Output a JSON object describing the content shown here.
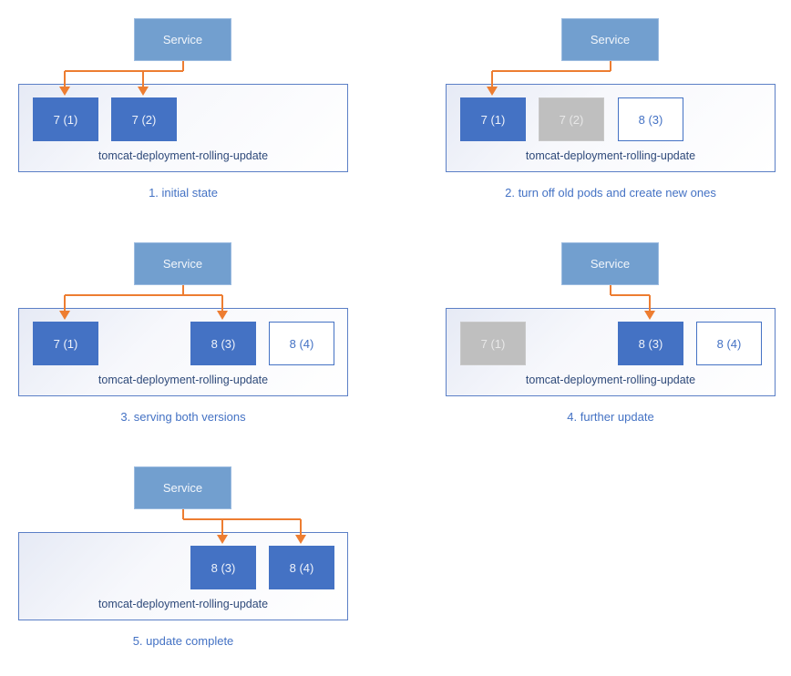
{
  "colors": {
    "service": "#729fcf",
    "pod_active": "#4472c4",
    "pod_off": "#bfbfbf",
    "pod_new_border": "#4472c4",
    "arrow": "#ed7d31",
    "caption": "#4472c4"
  },
  "panels": [
    {
      "service_label": "Service",
      "deployment_label": "tomcat-deployment-rolling-update",
      "caption": "1. initial state",
      "pods": [
        {
          "label": "7 (1)",
          "state": "active",
          "slot": 0
        },
        {
          "label": "7 (2)",
          "state": "active",
          "slot": 1
        }
      ],
      "routes_to_slots": [
        0,
        1
      ]
    },
    {
      "service_label": "Service",
      "deployment_label": "tomcat-deployment-rolling-update",
      "caption": "2. turn off old pods and create new ones",
      "pods": [
        {
          "label": "7 (1)",
          "state": "active",
          "slot": 0
        },
        {
          "label": "7 (2)",
          "state": "off",
          "slot": 1
        },
        {
          "label": "8 (3)",
          "state": "new",
          "slot": 2
        }
      ],
      "routes_to_slots": [
        0
      ]
    },
    {
      "service_label": "Service",
      "deployment_label": "tomcat-deployment-rolling-update",
      "caption": "3. serving both versions",
      "pods": [
        {
          "label": "7 (1)",
          "state": "active",
          "slot": 0
        },
        {
          "label": "8 (3)",
          "state": "active",
          "slot": 2
        },
        {
          "label": "8 (4)",
          "state": "new",
          "slot": 3
        }
      ],
      "routes_to_slots": [
        0,
        2
      ]
    },
    {
      "service_label": "Service",
      "deployment_label": "tomcat-deployment-rolling-update",
      "caption": "4. further update",
      "pods": [
        {
          "label": "7 (1)",
          "state": "off",
          "slot": 0
        },
        {
          "label": "8 (3)",
          "state": "active",
          "slot": 2
        },
        {
          "label": "8 (4)",
          "state": "new",
          "slot": 3
        }
      ],
      "routes_to_slots": [
        2
      ]
    },
    {
      "service_label": "Service",
      "deployment_label": "tomcat-deployment-rolling-update",
      "caption": "5. update complete",
      "pods": [
        {
          "label": "8 (3)",
          "state": "active",
          "slot": 2
        },
        {
          "label": "8 (4)",
          "state": "active",
          "slot": 3
        }
      ],
      "routes_to_slots": [
        2,
        3
      ]
    }
  ]
}
